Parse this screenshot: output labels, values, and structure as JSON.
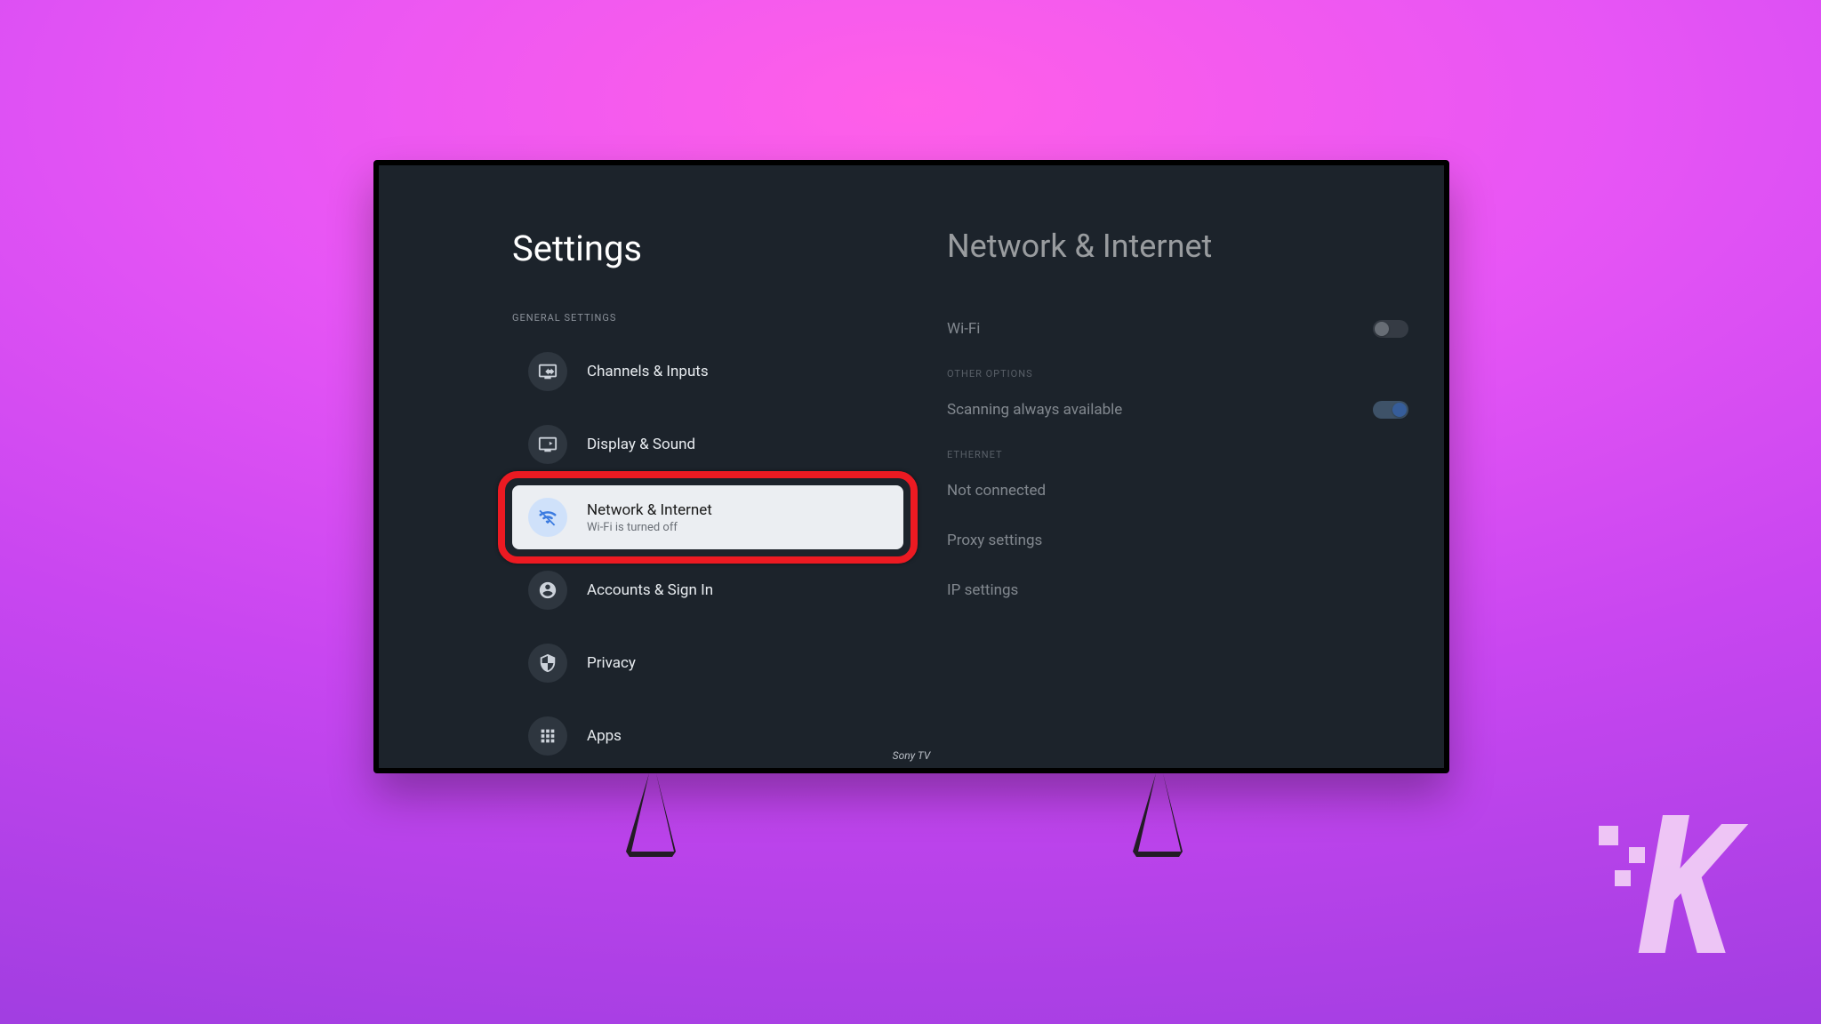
{
  "settings": {
    "title": "Settings",
    "sectionHeader": "GENERAL SETTINGS",
    "items": [
      {
        "label": "Channels & Inputs",
        "icon": "tv-input-icon"
      },
      {
        "label": "Display & Sound",
        "icon": "display-sound-icon"
      },
      {
        "label": "Network & Internet",
        "sublabel": "Wi-Fi is turned off",
        "icon": "wifi-off-icon",
        "selected": true,
        "highlighted": true
      },
      {
        "label": "Accounts & Sign In",
        "icon": "account-icon"
      },
      {
        "label": "Privacy",
        "icon": "privacy-icon"
      },
      {
        "label": "Apps",
        "icon": "apps-icon"
      }
    ]
  },
  "detail": {
    "title": "Network & Internet",
    "wifiLabel": "Wi-Fi",
    "wifiOn": false,
    "otherOptionsHeader": "OTHER OPTIONS",
    "scanningLabel": "Scanning always available",
    "scanningOn": true,
    "ethernetHeader": "ETHERNET",
    "ethernetStatus": "Not connected",
    "proxyLabel": "Proxy settings",
    "ipLabel": "IP settings"
  },
  "caption": "Sony TV",
  "logoText": "K"
}
